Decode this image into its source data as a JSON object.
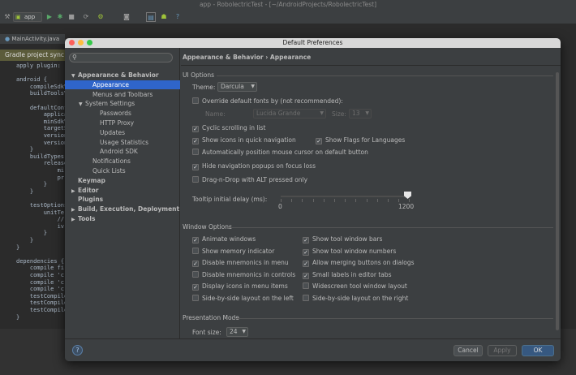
{
  "ide": {
    "window_title": "app - RobolectricTest - [~/AndroidProjects/RobolectricTest]",
    "run_config": "app",
    "file_tab": "MainActivity.java",
    "gradle_bar": "Gradle project sync",
    "code_lines": [
      "apply plugin:",
      "",
      "android {",
      "    compileSdkV",
      "    buildToolsV",
      "",
      "    defaultConf",
      "        applica",
      "        minSdkV",
      "        targetS",
      "        version",
      "        version",
      "    }",
      "    buildTypes",
      "        release",
      "            mi",
      "            pr",
      "        }",
      "    }",
      "",
      "    testOptions",
      "        unitTe",
      "            //",
      "            iv",
      "        }",
      "    }",
      "}",
      "",
      "dependencies {",
      "    compile fi",
      "    compile 'c",
      "    compile 'c",
      "    compile 'c",
      "    testCompile",
      "    testCompile",
      "    testCompile",
      "}"
    ]
  },
  "dialog": {
    "title": "Default Preferences",
    "breadcrumb": "Appearance & Behavior › Appearance",
    "tree": [
      {
        "label": "Appearance & Behavior",
        "arrow": "▼",
        "indent": 0,
        "bold": true,
        "selected": false
      },
      {
        "label": "Appearance",
        "arrow": "",
        "indent": 2,
        "bold": false,
        "selected": true
      },
      {
        "label": "Menus and Toolbars",
        "arrow": "",
        "indent": 2,
        "bold": false,
        "selected": false
      },
      {
        "label": "System Settings",
        "arrow": "▼",
        "indent": 1,
        "bold": false,
        "selected": false
      },
      {
        "label": "Passwords",
        "arrow": "",
        "indent": 3,
        "bold": false,
        "selected": false
      },
      {
        "label": "HTTP Proxy",
        "arrow": "",
        "indent": 3,
        "bold": false,
        "selected": false
      },
      {
        "label": "Updates",
        "arrow": "",
        "indent": 3,
        "bold": false,
        "selected": false
      },
      {
        "label": "Usage Statistics",
        "arrow": "",
        "indent": 3,
        "bold": false,
        "selected": false
      },
      {
        "label": "Android SDK",
        "arrow": "",
        "indent": 3,
        "bold": false,
        "selected": false
      },
      {
        "label": "Notifications",
        "arrow": "",
        "indent": 2,
        "bold": false,
        "selected": false
      },
      {
        "label": "Quick Lists",
        "arrow": "",
        "indent": 2,
        "bold": false,
        "selected": false
      },
      {
        "label": "Keymap",
        "arrow": "",
        "indent": 0,
        "bold": true,
        "selected": false
      },
      {
        "label": "Editor",
        "arrow": "▶",
        "indent": 0,
        "bold": true,
        "selected": false
      },
      {
        "label": "Plugins",
        "arrow": "",
        "indent": 0,
        "bold": true,
        "selected": false
      },
      {
        "label": "Build, Execution, Deployment",
        "arrow": "▶",
        "indent": 0,
        "bold": true,
        "selected": false
      },
      {
        "label": "Tools",
        "arrow": "▶",
        "indent": 0,
        "bold": true,
        "selected": false
      }
    ],
    "ui_options": {
      "header": "UI Options",
      "theme_label": "Theme:",
      "theme_value": "Darcula",
      "override_fonts": {
        "label": "Override default fonts by (not recommended):",
        "checked": false
      },
      "font_name_label": "Name:",
      "font_name_value": "Lucida Grande",
      "font_size_label": "Size:",
      "font_size_value": "13",
      "cyclic_scrolling": {
        "label": "Cyclic scrolling in list",
        "checked": true
      },
      "show_icons_quick_nav": {
        "label": "Show icons in quick navigation",
        "checked": true
      },
      "show_flags_languages": {
        "label": "Show Flags for Languages",
        "checked": true
      },
      "auto_position_mouse": {
        "label": "Automatically position mouse cursor on default button",
        "checked": false
      },
      "hide_nav_popups": {
        "label": "Hide navigation popups on focus loss",
        "checked": true
      },
      "drag_drop_alt": {
        "label": "Drag-n-Drop with ALT pressed only",
        "checked": false
      },
      "tooltip_delay_label": "Tooltip initial delay (ms):",
      "tooltip_delay_min": "0",
      "tooltip_delay_max": "1200",
      "tooltip_delay_value": 1200
    },
    "window_options": {
      "header": "Window Options",
      "left": [
        {
          "label": "Animate windows",
          "checked": true
        },
        {
          "label": "Show memory indicator",
          "checked": false
        },
        {
          "label": "Disable mnemonics in menu",
          "checked": true
        },
        {
          "label": "Disable mnemonics in controls",
          "checked": false
        },
        {
          "label": "Display icons in menu items",
          "checked": true
        },
        {
          "label": "Side-by-side layout on the left",
          "checked": false
        }
      ],
      "right": [
        {
          "label": "Show tool window bars",
          "checked": true
        },
        {
          "label": "Show tool window numbers",
          "checked": true
        },
        {
          "label": "Allow merging buttons on dialogs",
          "checked": true
        },
        {
          "label": "Small labels in editor tabs",
          "checked": true
        },
        {
          "label": "Widescreen tool window layout",
          "checked": false
        },
        {
          "label": "Side-by-side layout on the right",
          "checked": false
        }
      ]
    },
    "presentation": {
      "header": "Presentation Mode",
      "font_size_label": "Font size:",
      "font_size_value": "24"
    },
    "buttons": {
      "cancel": "Cancel",
      "apply": "Apply",
      "ok": "OK",
      "help": "?"
    }
  },
  "colors": {
    "accent": "#2f65ca",
    "panel": "#3c3f41",
    "editor": "#2b2b2b",
    "default_button": "#365880"
  }
}
